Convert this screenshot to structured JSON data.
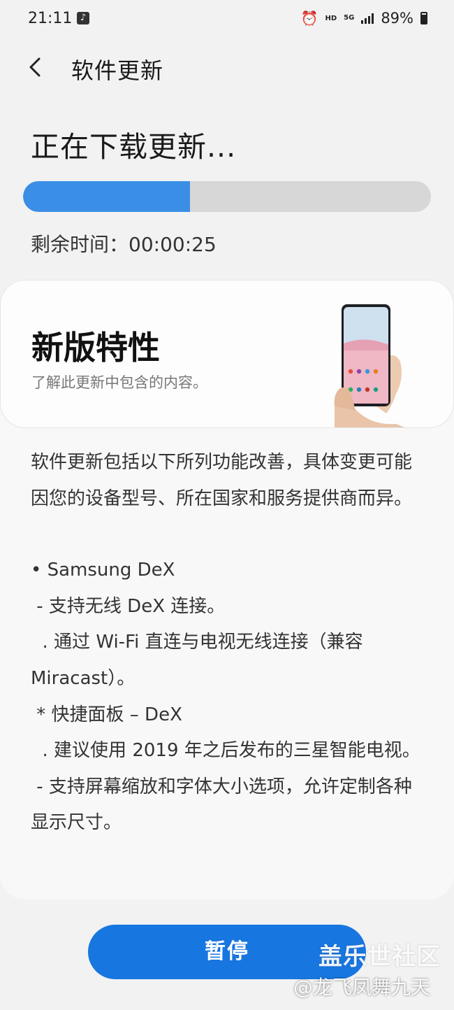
{
  "status_bar": {
    "time": "21:11",
    "icons": [
      "music-icon",
      "alarm-icon",
      "hd-icon",
      "5g-icon",
      "signal-icon",
      "battery-icon"
    ],
    "hd": "HD",
    "network": "5G",
    "battery": "89%"
  },
  "header": {
    "title": "软件更新",
    "back_icon": "chevron-left-icon"
  },
  "download": {
    "status": "正在下载更新...",
    "progress_percent": 41,
    "remaining_label": "剩余时间：00:00:25"
  },
  "features": {
    "title": "新版特性",
    "subtitle": "了解此更新中包含的内容。",
    "intro": "软件更新包括以下所列功能改善，具体变更可能因您的设备型号、所在国家和服务提供商而异。",
    "lines": [
      "• Samsung DeX",
      " - 支持无线 DeX 连接。",
      "  . 通过 Wi-Fi 直连与电视无线连接（兼容Miracast）。",
      " * 快捷面板 – DeX",
      "  . 建议使用 2019 年之后发布的三星智能电视。",
      " - 支持屏幕缩放和字体大小选项，允许定制各种显示尺寸。"
    ]
  },
  "actions": {
    "pause_label": "暂停"
  },
  "watermark": {
    "title": "盖乐世社区",
    "author": "@龙飞凤舞九天"
  },
  "colors": {
    "accent": "#1876e0",
    "progress": "#3a8ee6",
    "background": "#f2f2f2"
  }
}
